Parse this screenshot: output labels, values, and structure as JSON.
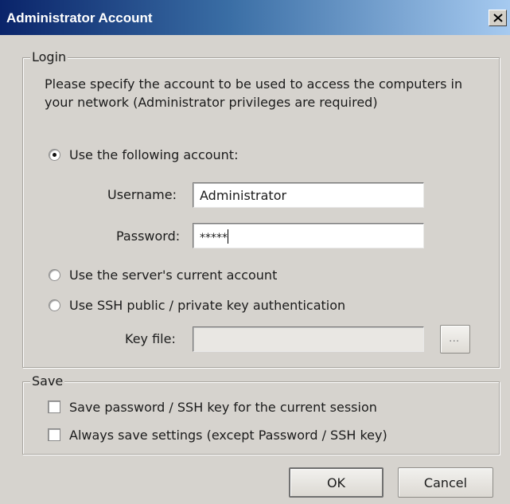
{
  "window": {
    "title": "Administrator Account",
    "close_label": "X"
  },
  "login": {
    "legend": "Login",
    "description_line1": "Please specify the account to be used to access the computers in",
    "description_line2": "your network (Administrator privileges are required)",
    "option_following_account": "Use the following account:",
    "option_following_account_selected": true,
    "username_label": "Username:",
    "username_value": "Administrator",
    "password_label": "Password:",
    "password_masked": "*****",
    "option_server_account": "Use the server's current account",
    "option_server_account_selected": false,
    "option_ssh_key": "Use SSH public / private key authentication",
    "option_ssh_key_selected": false,
    "keyfile_label": "Key file:",
    "keyfile_value": "",
    "browse_label": "..."
  },
  "save": {
    "legend": "Save",
    "save_session_label": "Save password / SSH key for the current session",
    "save_session_checked": false,
    "always_save_label": "Always save settings (except Password / SSH key)",
    "always_save_checked": false
  },
  "buttons": {
    "ok": "OK",
    "cancel": "Cancel"
  },
  "colors": {
    "title_gradient_start": "#0a246a",
    "title_gradient_end": "#a6caf0",
    "dialog_background": "#d6d3ce"
  }
}
